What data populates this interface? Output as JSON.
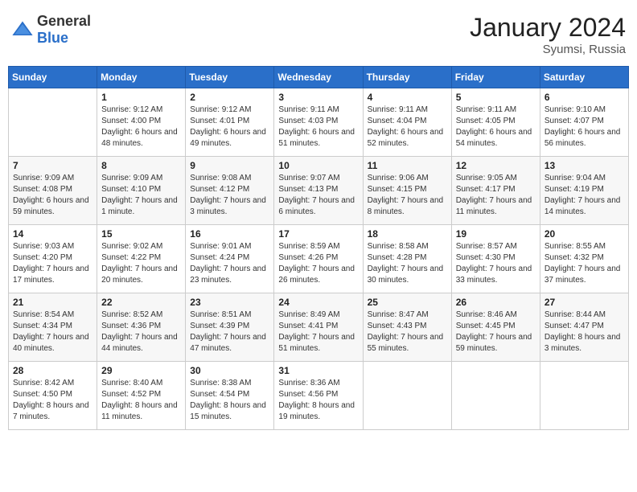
{
  "header": {
    "logo_general": "General",
    "logo_blue": "Blue",
    "month_year": "January 2024",
    "location": "Syumsi, Russia"
  },
  "weekdays": [
    "Sunday",
    "Monday",
    "Tuesday",
    "Wednesday",
    "Thursday",
    "Friday",
    "Saturday"
  ],
  "weeks": [
    [
      {
        "day": "",
        "sunrise": "",
        "sunset": "",
        "daylight": ""
      },
      {
        "day": "1",
        "sunrise": "Sunrise: 9:12 AM",
        "sunset": "Sunset: 4:00 PM",
        "daylight": "Daylight: 6 hours and 48 minutes."
      },
      {
        "day": "2",
        "sunrise": "Sunrise: 9:12 AM",
        "sunset": "Sunset: 4:01 PM",
        "daylight": "Daylight: 6 hours and 49 minutes."
      },
      {
        "day": "3",
        "sunrise": "Sunrise: 9:11 AM",
        "sunset": "Sunset: 4:03 PM",
        "daylight": "Daylight: 6 hours and 51 minutes."
      },
      {
        "day": "4",
        "sunrise": "Sunrise: 9:11 AM",
        "sunset": "Sunset: 4:04 PM",
        "daylight": "Daylight: 6 hours and 52 minutes."
      },
      {
        "day": "5",
        "sunrise": "Sunrise: 9:11 AM",
        "sunset": "Sunset: 4:05 PM",
        "daylight": "Daylight: 6 hours and 54 minutes."
      },
      {
        "day": "6",
        "sunrise": "Sunrise: 9:10 AM",
        "sunset": "Sunset: 4:07 PM",
        "daylight": "Daylight: 6 hours and 56 minutes."
      }
    ],
    [
      {
        "day": "7",
        "sunrise": "Sunrise: 9:09 AM",
        "sunset": "Sunset: 4:08 PM",
        "daylight": "Daylight: 6 hours and 59 minutes."
      },
      {
        "day": "8",
        "sunrise": "Sunrise: 9:09 AM",
        "sunset": "Sunset: 4:10 PM",
        "daylight": "Daylight: 7 hours and 1 minute."
      },
      {
        "day": "9",
        "sunrise": "Sunrise: 9:08 AM",
        "sunset": "Sunset: 4:12 PM",
        "daylight": "Daylight: 7 hours and 3 minutes."
      },
      {
        "day": "10",
        "sunrise": "Sunrise: 9:07 AM",
        "sunset": "Sunset: 4:13 PM",
        "daylight": "Daylight: 7 hours and 6 minutes."
      },
      {
        "day": "11",
        "sunrise": "Sunrise: 9:06 AM",
        "sunset": "Sunset: 4:15 PM",
        "daylight": "Daylight: 7 hours and 8 minutes."
      },
      {
        "day": "12",
        "sunrise": "Sunrise: 9:05 AM",
        "sunset": "Sunset: 4:17 PM",
        "daylight": "Daylight: 7 hours and 11 minutes."
      },
      {
        "day": "13",
        "sunrise": "Sunrise: 9:04 AM",
        "sunset": "Sunset: 4:19 PM",
        "daylight": "Daylight: 7 hours and 14 minutes."
      }
    ],
    [
      {
        "day": "14",
        "sunrise": "Sunrise: 9:03 AM",
        "sunset": "Sunset: 4:20 PM",
        "daylight": "Daylight: 7 hours and 17 minutes."
      },
      {
        "day": "15",
        "sunrise": "Sunrise: 9:02 AM",
        "sunset": "Sunset: 4:22 PM",
        "daylight": "Daylight: 7 hours and 20 minutes."
      },
      {
        "day": "16",
        "sunrise": "Sunrise: 9:01 AM",
        "sunset": "Sunset: 4:24 PM",
        "daylight": "Daylight: 7 hours and 23 minutes."
      },
      {
        "day": "17",
        "sunrise": "Sunrise: 8:59 AM",
        "sunset": "Sunset: 4:26 PM",
        "daylight": "Daylight: 7 hours and 26 minutes."
      },
      {
        "day": "18",
        "sunrise": "Sunrise: 8:58 AM",
        "sunset": "Sunset: 4:28 PM",
        "daylight": "Daylight: 7 hours and 30 minutes."
      },
      {
        "day": "19",
        "sunrise": "Sunrise: 8:57 AM",
        "sunset": "Sunset: 4:30 PM",
        "daylight": "Daylight: 7 hours and 33 minutes."
      },
      {
        "day": "20",
        "sunrise": "Sunrise: 8:55 AM",
        "sunset": "Sunset: 4:32 PM",
        "daylight": "Daylight: 7 hours and 37 minutes."
      }
    ],
    [
      {
        "day": "21",
        "sunrise": "Sunrise: 8:54 AM",
        "sunset": "Sunset: 4:34 PM",
        "daylight": "Daylight: 7 hours and 40 minutes."
      },
      {
        "day": "22",
        "sunrise": "Sunrise: 8:52 AM",
        "sunset": "Sunset: 4:36 PM",
        "daylight": "Daylight: 7 hours and 44 minutes."
      },
      {
        "day": "23",
        "sunrise": "Sunrise: 8:51 AM",
        "sunset": "Sunset: 4:39 PM",
        "daylight": "Daylight: 7 hours and 47 minutes."
      },
      {
        "day": "24",
        "sunrise": "Sunrise: 8:49 AM",
        "sunset": "Sunset: 4:41 PM",
        "daylight": "Daylight: 7 hours and 51 minutes."
      },
      {
        "day": "25",
        "sunrise": "Sunrise: 8:47 AM",
        "sunset": "Sunset: 4:43 PM",
        "daylight": "Daylight: 7 hours and 55 minutes."
      },
      {
        "day": "26",
        "sunrise": "Sunrise: 8:46 AM",
        "sunset": "Sunset: 4:45 PM",
        "daylight": "Daylight: 7 hours and 59 minutes."
      },
      {
        "day": "27",
        "sunrise": "Sunrise: 8:44 AM",
        "sunset": "Sunset: 4:47 PM",
        "daylight": "Daylight: 8 hours and 3 minutes."
      }
    ],
    [
      {
        "day": "28",
        "sunrise": "Sunrise: 8:42 AM",
        "sunset": "Sunset: 4:50 PM",
        "daylight": "Daylight: 8 hours and 7 minutes."
      },
      {
        "day": "29",
        "sunrise": "Sunrise: 8:40 AM",
        "sunset": "Sunset: 4:52 PM",
        "daylight": "Daylight: 8 hours and 11 minutes."
      },
      {
        "day": "30",
        "sunrise": "Sunrise: 8:38 AM",
        "sunset": "Sunset: 4:54 PM",
        "daylight": "Daylight: 8 hours and 15 minutes."
      },
      {
        "day": "31",
        "sunrise": "Sunrise: 8:36 AM",
        "sunset": "Sunset: 4:56 PM",
        "daylight": "Daylight: 8 hours and 19 minutes."
      },
      {
        "day": "",
        "sunrise": "",
        "sunset": "",
        "daylight": ""
      },
      {
        "day": "",
        "sunrise": "",
        "sunset": "",
        "daylight": ""
      },
      {
        "day": "",
        "sunrise": "",
        "sunset": "",
        "daylight": ""
      }
    ]
  ]
}
